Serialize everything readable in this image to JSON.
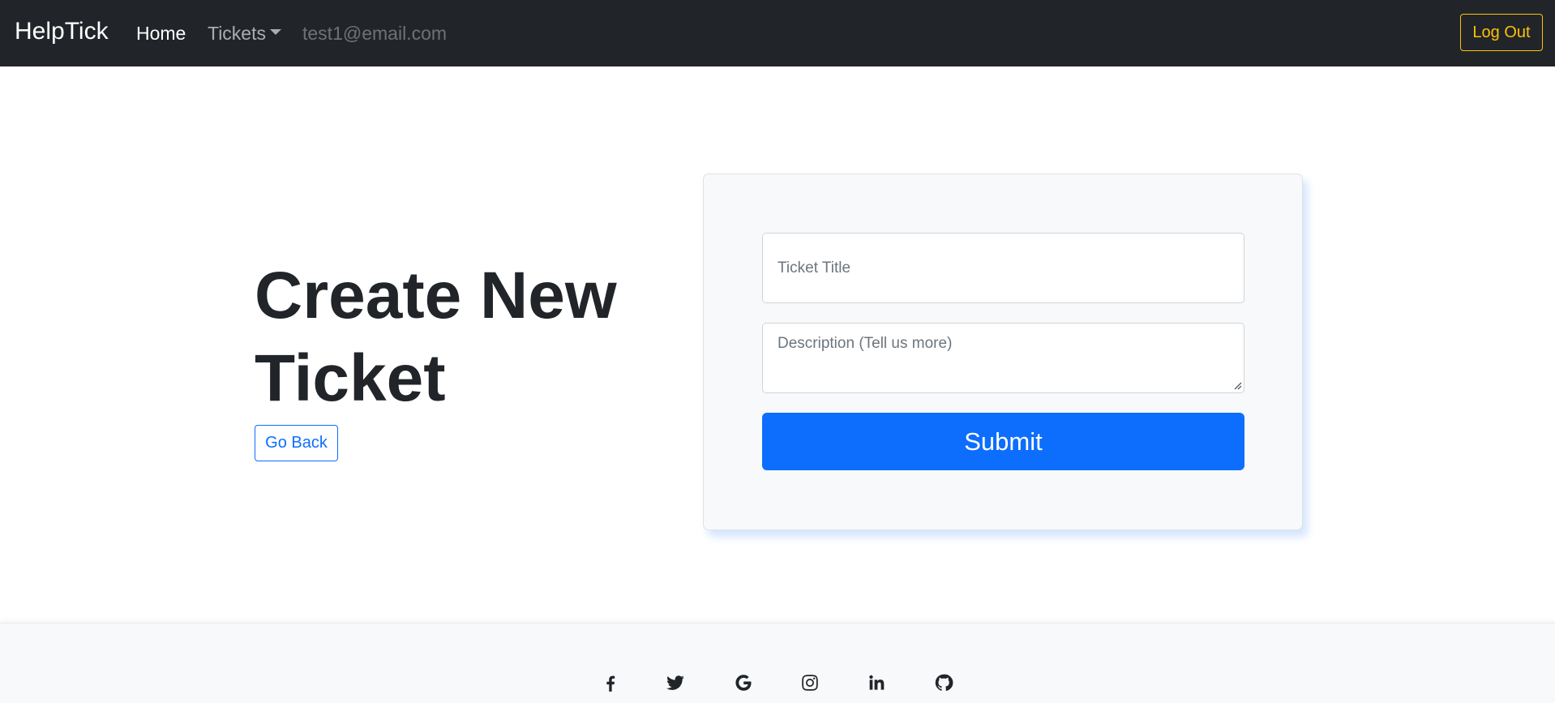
{
  "navbar": {
    "brand": "HelpTick",
    "home_label": "Home",
    "tickets_label": "Tickets",
    "user_email": "test1@email.com",
    "logout_label": "Log Out"
  },
  "hero": {
    "title": "Create New Ticket",
    "go_back_label": "Go Back"
  },
  "form": {
    "title_placeholder": "Ticket Title",
    "title_value": "",
    "description_placeholder": "Description (Tell us more)",
    "description_value": "",
    "submit_label": "Submit"
  },
  "footer": {
    "social_icons": [
      "facebook-icon",
      "twitter-icon",
      "google-icon",
      "instagram-icon",
      "linkedin-icon",
      "github-icon"
    ]
  },
  "colors": {
    "navbar_bg": "#212529",
    "primary": "#0d6efd",
    "warning": "#ffc107",
    "card_bg": "#f8f9fa"
  }
}
